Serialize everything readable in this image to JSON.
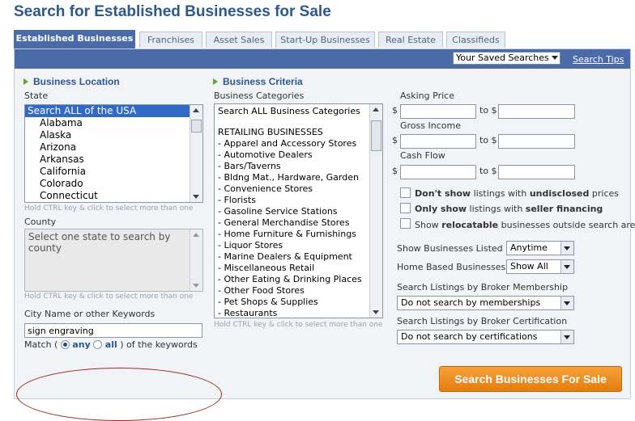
{
  "page": {
    "title": "Search for Established Businesses for Sale"
  },
  "tabs": [
    {
      "label": "Established Businesses",
      "active": true
    },
    {
      "label": "Franchises"
    },
    {
      "label": "Asset Sales"
    },
    {
      "label": "Start-Up Businesses"
    },
    {
      "label": "Real Estate"
    },
    {
      "label": "Classifieds"
    }
  ],
  "toolbar": {
    "saved_searches": "Your Saved Searches",
    "search_tips": "Search Tips"
  },
  "location": {
    "heading": "Business Location",
    "state_label": "State",
    "states": [
      "Search ALL of the USA",
      "Alabama",
      "Alaska",
      "Arizona",
      "Arkansas",
      "California",
      "Colorado",
      "Connecticut"
    ],
    "state_hint": "Hold CTRL key & click to select more than one",
    "county_label": "County",
    "county_placeholder": "Select one state to search by county",
    "county_hint": "Hold CTRL key & click to select more than one",
    "keywords_label": "City Name or other Keywords",
    "keywords_value": "sign engraving",
    "match_prefix": "Match (",
    "match_any": "any",
    "match_all": "all",
    "match_suffix": ") of the keywords"
  },
  "criteria": {
    "heading": "Business Criteria",
    "categories_label": "Business Categories",
    "categories_first": "Search ALL Business Categories",
    "categories_group": "RETAILING BUSINESSES",
    "categories": [
      "- Apparel and Accessory Stores",
      "- Automotive Dealers",
      "- Bars/Taverns",
      "- Bldng Mat., Hardware, Garden",
      "- Convenience Stores",
      "- Florists",
      "- Gasoline Service Stations",
      "- General Merchandise Stores",
      "- Home Furniture & Furnishings",
      "- Liquor Stores",
      "- Marine Dealers & Equipment",
      "- Miscellaneous Retail",
      "- Other Eating & Drinking Places",
      "- Other Food Stores",
      "- Pet Shops & Supplies",
      "- Restaurants"
    ],
    "categories_hint": "Hold CTRL key & click to select more than one"
  },
  "filters": {
    "asking_price": "Asking Price",
    "gross_income": "Gross Income",
    "cash_flow": "Cash Flow",
    "currency": "$",
    "to": "to $",
    "chk1_a": "Don't show",
    "chk1_b": " listings with ",
    "chk1_c": "undisclosed",
    "chk1_d": " prices",
    "chk2_a": "Only show",
    "chk2_b": " listings with ",
    "chk2_c": "seller financing",
    "chk3_a": "Show ",
    "chk3_b": "relocatable",
    "chk3_c": " businesses outside search area",
    "listed_label": "Show Businesses Listed",
    "listed_value": "Anytime",
    "home_label": "Home Based Businesses",
    "home_value": "Show All",
    "membership_label": "Search Listings by Broker Membership",
    "membership_value": "Do not search by memberships",
    "certification_label": "Search Listings by Broker Certification",
    "certification_value": "Do not search by certifications"
  },
  "actions": {
    "search_button": "Search Businesses For Sale"
  }
}
